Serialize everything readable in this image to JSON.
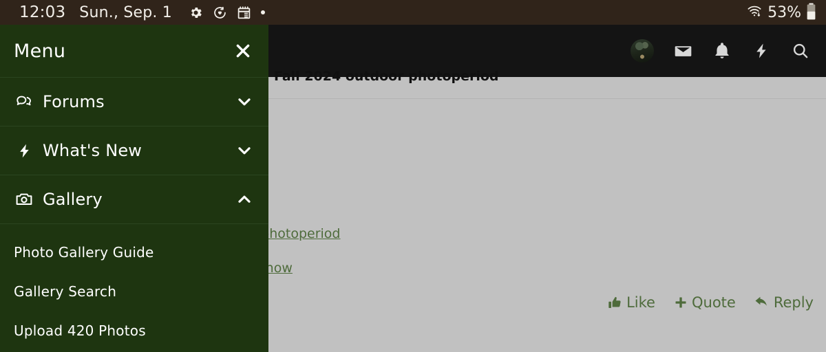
{
  "status_bar": {
    "time": "12:03",
    "date": "Sun., Sep. 1",
    "icons": [
      "gear-icon",
      "heart-sync-icon",
      "calendar-icon",
      "dot-icon"
    ],
    "wifi_icon": "wifi-updown-icon",
    "battery_percent": "53%",
    "battery_icon": "battery-icon",
    "background_color": "#30241a",
    "text_color": "#f2efe9"
  },
  "app_header": {
    "background_color": "#141414",
    "icons": [
      {
        "name": "avatar",
        "label": "user-avatar"
      },
      {
        "name": "inbox-icon",
        "label": "Inbox"
      },
      {
        "name": "bell-icon",
        "label": "Alerts"
      },
      {
        "name": "bolt-icon",
        "label": "What's New"
      },
      {
        "name": "search-icon",
        "label": "Search"
      }
    ]
  },
  "drawer": {
    "title": "Menu",
    "close_icon": "close-icon",
    "background_color": "#1e3510",
    "items": [
      {
        "label": "Forums",
        "icon": "comments-icon",
        "chevron": "chevron-down-icon",
        "expanded": false
      },
      {
        "label": "What's New",
        "icon": "bolt-icon",
        "chevron": "chevron-down-icon",
        "expanded": false
      },
      {
        "label": "Gallery",
        "icon": "camera-icon",
        "chevron": "chevron-up-icon",
        "expanded": true
      }
    ],
    "gallery_submenu": [
      {
        "label": "Photo Gallery Guide"
      },
      {
        "label": "Gallery Search"
      },
      {
        "label": "Upload 420 Photos"
      }
    ]
  },
  "content": {
    "thread_title_clipped": "Fall 2024 outdoor photoperiod",
    "links": [
      {
        "text": "door photoperiod"
      },
      {
        "text": "d to Know"
      }
    ],
    "link_color": "#4e6b3b",
    "background_color": "#c1c1c1",
    "actions": [
      {
        "label": "Like",
        "icon": "thumbs-up-icon"
      },
      {
        "label": "Quote",
        "icon": "plus-icon"
      },
      {
        "label": "Reply",
        "icon": "reply-arrow-icon"
      }
    ]
  }
}
